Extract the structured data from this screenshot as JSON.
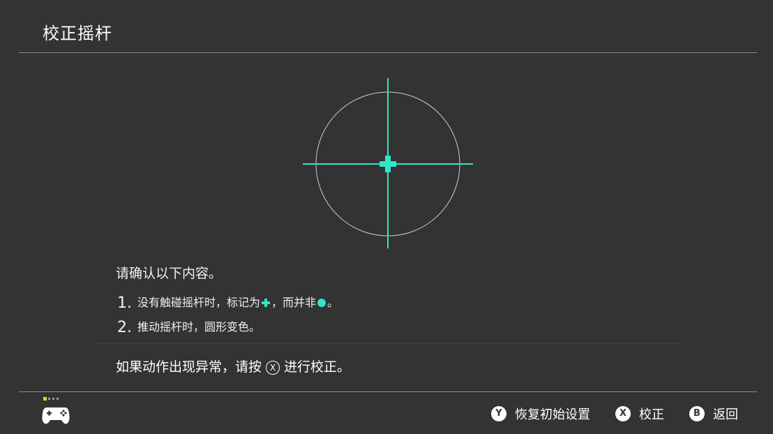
{
  "header": {
    "title": "校正摇杆"
  },
  "colors": {
    "accent": "#2fe6c8",
    "background": "#333333"
  },
  "instructions": {
    "title": "请确认以下内容。",
    "steps": [
      {
        "number": "1.",
        "text_a": "没有触碰摇杆时，标记为",
        "text_b": "，而并非",
        "text_c": "。",
        "icons": [
          "plus-marker",
          "dot-marker"
        ]
      },
      {
        "number": "2.",
        "text": "推动摇杆时，圆形变色。"
      }
    ]
  },
  "note": {
    "text_before": "如果动作出现异常，请按",
    "button": "X",
    "text_after": "进行校正。"
  },
  "footer": {
    "icon": "controller-icon",
    "buttons": [
      {
        "key": "Y",
        "label": "恢复初始设置"
      },
      {
        "key": "X",
        "label": "校正"
      },
      {
        "key": "B",
        "label": "返回"
      }
    ]
  }
}
